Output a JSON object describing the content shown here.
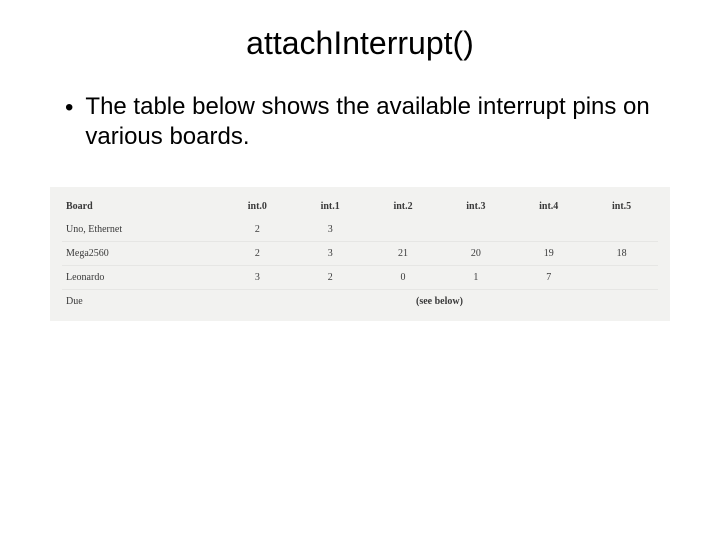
{
  "title": "attachInterrupt()",
  "bullet": "The table below shows the available interrupt pins on various boards.",
  "table": {
    "headers": [
      "Board",
      "int.0",
      "int.1",
      "int.2",
      "int.3",
      "int.4",
      "int.5"
    ],
    "rows": [
      {
        "board": "Uno, Ethernet",
        "c0": "2",
        "c1": "3",
        "c2": "",
        "c3": "",
        "c4": "",
        "c5": ""
      },
      {
        "board": "Mega2560",
        "c0": "2",
        "c1": "3",
        "c2": "21",
        "c3": "20",
        "c4": "19",
        "c5": "18"
      },
      {
        "board": "Leonardo",
        "c0": "3",
        "c1": "2",
        "c2": "0",
        "c3": "1",
        "c4": "7",
        "c5": ""
      }
    ],
    "dueLabel": "Due",
    "seeBelow": "(see below)"
  }
}
